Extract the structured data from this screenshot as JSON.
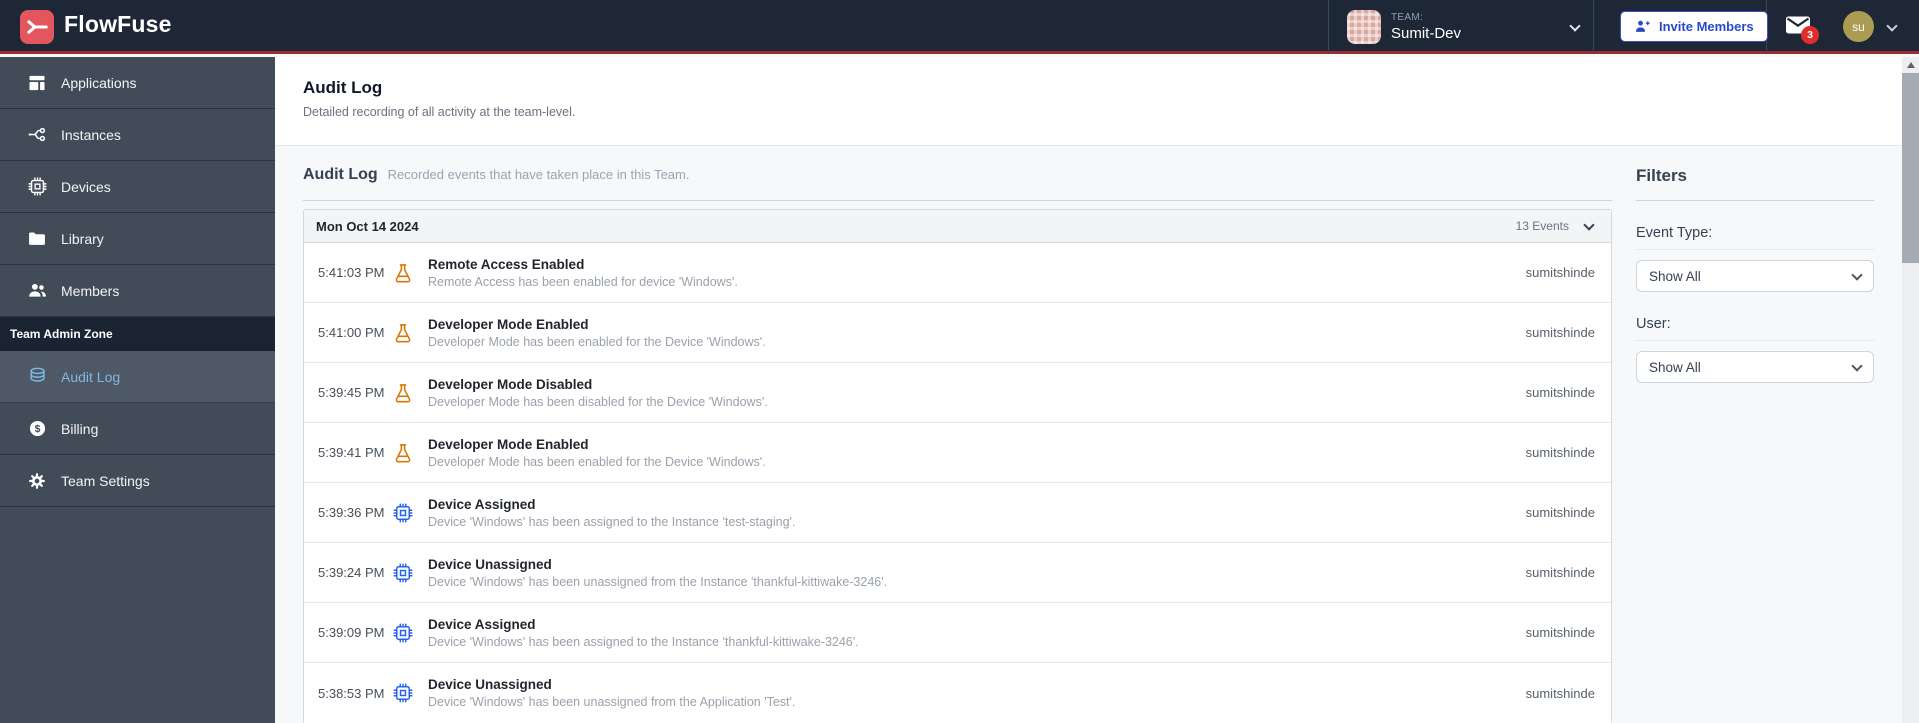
{
  "header": {
    "brand": "FlowFuse",
    "team_label": "TEAM:",
    "team_name": "Sumit-Dev",
    "invite_button": "Invite Members",
    "notification_count": "3",
    "avatar_initials": "su"
  },
  "sidebar": {
    "items": [
      {
        "label": "Applications"
      },
      {
        "label": "Instances"
      },
      {
        "label": "Devices"
      },
      {
        "label": "Library"
      },
      {
        "label": "Members"
      }
    ],
    "section_label": "Team Admin Zone",
    "admin_items": [
      {
        "label": "Audit Log"
      },
      {
        "label": "Billing"
      },
      {
        "label": "Team Settings"
      }
    ]
  },
  "page": {
    "title": "Audit Log",
    "subtitle": "Detailed recording of all activity at the team-level."
  },
  "section": {
    "title": "Audit Log",
    "subtitle": "Recorded events that have taken place in this Team."
  },
  "log": {
    "date": "Mon Oct 14 2024",
    "events_count": "13 Events",
    "rows": [
      {
        "time": "5:41:03 PM",
        "icon": "flask-icon",
        "title": "Remote Access Enabled",
        "description": "Remote Access has been enabled for device 'Windows'.",
        "user": "sumitshinde"
      },
      {
        "time": "5:41:00 PM",
        "icon": "flask-icon",
        "title": "Developer Mode Enabled",
        "description": "Developer Mode has been enabled for the Device 'Windows'.",
        "user": "sumitshinde"
      },
      {
        "time": "5:39:45 PM",
        "icon": "flask-icon",
        "title": "Developer Mode Disabled",
        "description": "Developer Mode has been disabled for the Device 'Windows'.",
        "user": "sumitshinde"
      },
      {
        "time": "5:39:41 PM",
        "icon": "flask-icon",
        "title": "Developer Mode Enabled",
        "description": "Developer Mode has been enabled for the Device 'Windows'.",
        "user": "sumitshinde"
      },
      {
        "time": "5:39:36 PM",
        "icon": "chip-icon",
        "title": "Device Assigned",
        "description": "Device 'Windows' has been assigned to the Instance 'test-staging'.",
        "user": "sumitshinde"
      },
      {
        "time": "5:39:24 PM",
        "icon": "chip-icon",
        "title": "Device Unassigned",
        "description": "Device 'Windows' has been unassigned from the Instance 'thankful-kittiwake-3246'.",
        "user": "sumitshinde"
      },
      {
        "time": "5:39:09 PM",
        "icon": "chip-icon",
        "title": "Device Assigned",
        "description": "Device 'Windows' has been assigned to the Instance 'thankful-kittiwake-3246'.",
        "user": "sumitshinde"
      },
      {
        "time": "5:38:53 PM",
        "icon": "chip-icon",
        "title": "Device Unassigned",
        "description": "Device 'Windows' has been unassigned from the Application 'Test'.",
        "user": "sumitshinde"
      }
    ]
  },
  "filters": {
    "title": "Filters",
    "event_type_label": "Event Type:",
    "event_type_value": "Show All",
    "user_label": "User:",
    "user_value": "Show All"
  },
  "colors": {
    "header_bg": "#1d2735",
    "header_accent_line": "#9e2a33",
    "brand_red": "#e4565e",
    "sidebar_bg": "#414c58",
    "sidebar_active_text": "#7db7e8",
    "flask_icon": "#d97706",
    "chip_icon": "#2563eb",
    "invite_blue": "#2a49c9",
    "badge_red": "#e02d2d",
    "avatar_olive": "#ac9b52",
    "team_avatar_pink": "#d9a89f"
  }
}
